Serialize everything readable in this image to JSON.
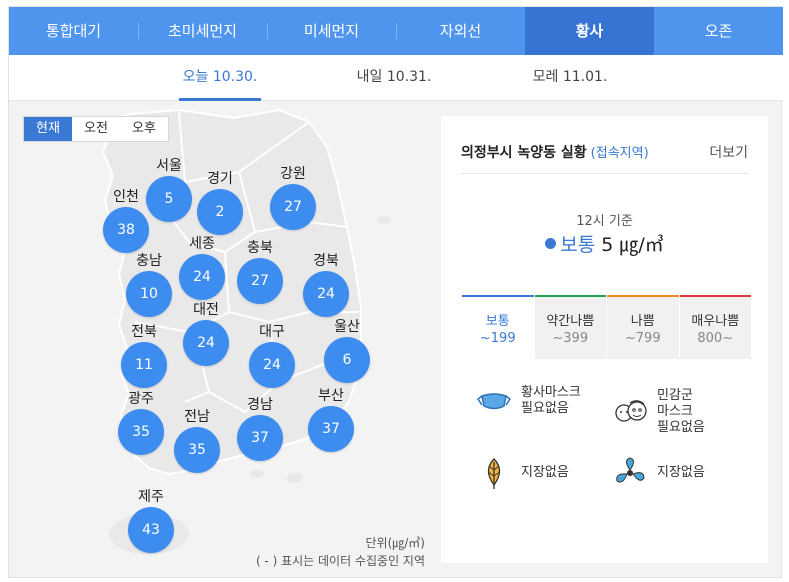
{
  "tabs": [
    {
      "label": "통합대기"
    },
    {
      "label": "초미세먼지"
    },
    {
      "label": "미세먼지"
    },
    {
      "label": "자외선"
    },
    {
      "label": "황사"
    },
    {
      "label": "오존"
    }
  ],
  "active_tab": "황사",
  "dates": [
    {
      "label": "오늘 10.30."
    },
    {
      "label": "내일 10.31."
    },
    {
      "label": "모레 11.01."
    }
  ],
  "time_tabs": [
    {
      "label": "현재"
    },
    {
      "label": "오전"
    },
    {
      "label": "오후"
    }
  ],
  "cities": [
    {
      "name": "서울",
      "value": "5"
    },
    {
      "name": "경기",
      "value": "2"
    },
    {
      "name": "강원",
      "value": "27"
    },
    {
      "name": "인천",
      "value": "38"
    },
    {
      "name": "충남",
      "value": "10"
    },
    {
      "name": "세종",
      "value": "24"
    },
    {
      "name": "충북",
      "value": "27"
    },
    {
      "name": "경북",
      "value": "24"
    },
    {
      "name": "전북",
      "value": "11"
    },
    {
      "name": "대전",
      "value": "24"
    },
    {
      "name": "대구",
      "value": "24"
    },
    {
      "name": "울산",
      "value": "6"
    },
    {
      "name": "광주",
      "value": "35"
    },
    {
      "name": "전남",
      "value": "35"
    },
    {
      "name": "경남",
      "value": "37"
    },
    {
      "name": "부산",
      "value": "37"
    },
    {
      "name": "제주",
      "value": "43"
    }
  ],
  "unit_note": {
    "unit": "단위(㎍/㎥)",
    "legend": "( - ) 표시는 데이터 수집중인 지역"
  },
  "panel": {
    "location": "의정부시 녹양동 실황",
    "location_sub": "(접속지역)",
    "more": "더보기",
    "basis": "12시 기준",
    "status_word": "보통",
    "status_value": "5 ㎍/㎥"
  },
  "grades": [
    {
      "name": "보통",
      "range": "~199",
      "color": "#3a78d6"
    },
    {
      "name": "약간나쁨",
      "range": "~399",
      "color": "#27a05a"
    },
    {
      "name": "나쁨",
      "range": "~799",
      "color": "#f08a1c"
    },
    {
      "name": "매우나쁨",
      "range": "800~",
      "color": "#e23a3a"
    }
  ],
  "advice": [
    {
      "icon": "mask-icon",
      "text": "황사마스크\n필요없음"
    },
    {
      "icon": "sensitive-group-icon",
      "text": "민감군\n마스크\n필요없음"
    },
    {
      "icon": "leaf-icon",
      "text": "지장없음"
    },
    {
      "icon": "fan-icon",
      "text": "지장없음"
    }
  ],
  "colors": {
    "accent": "#3a78d6",
    "tab_bar": "#4f95ee",
    "bubble": "#3d8df0"
  }
}
